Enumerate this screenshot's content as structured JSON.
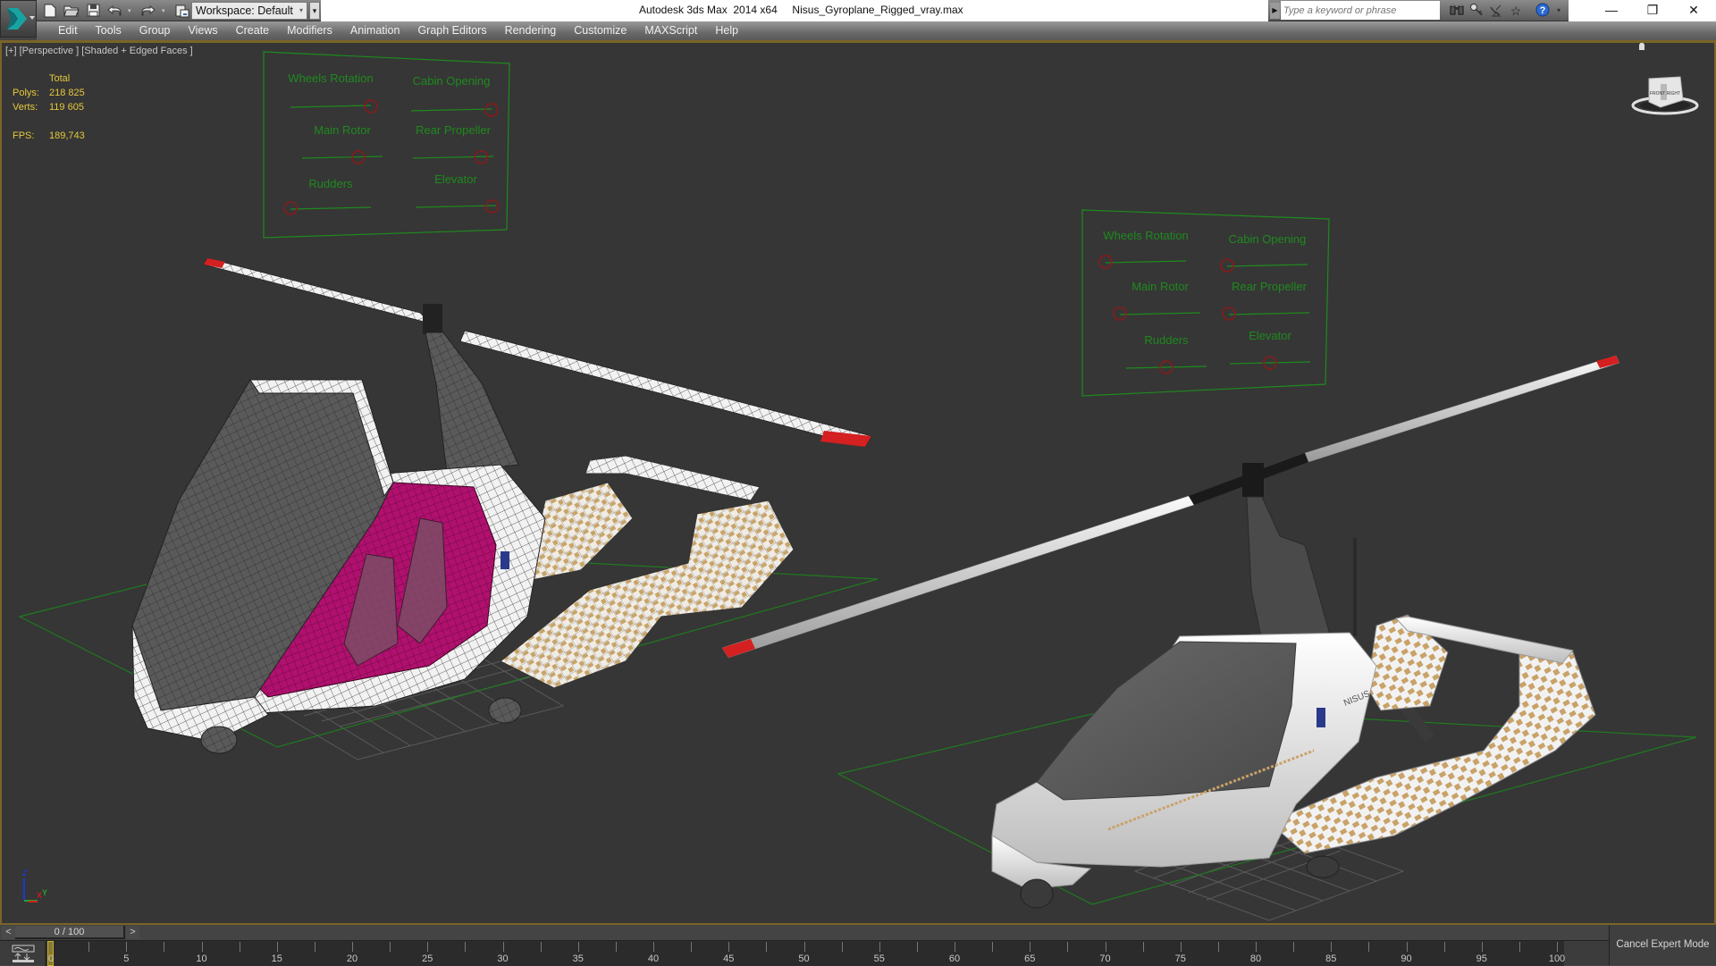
{
  "app": {
    "title": "Autodesk 3ds Max  2014 x64     Nisus_Gyroplane_Rigged_vray.max",
    "workspace": "Workspace: Default"
  },
  "quick_access": [
    {
      "name": "new-file-icon",
      "glyph": "🗋"
    },
    {
      "name": "open-file-icon",
      "glyph": "📂"
    },
    {
      "name": "save-icon",
      "glyph": "💾"
    },
    {
      "name": "undo-icon",
      "glyph": "↶"
    },
    {
      "name": "redo-icon",
      "glyph": "↷"
    },
    {
      "name": "project-folder-icon",
      "glyph": "🗂"
    }
  ],
  "search": {
    "placeholder": "Type a keyword or phrase"
  },
  "infocenter": [
    {
      "name": "binoculars-icon",
      "glyph": "⌕"
    },
    {
      "name": "key-icon",
      "glyph": "⚷"
    },
    {
      "name": "satellite-icon",
      "glyph": "📡"
    },
    {
      "name": "star-icon",
      "glyph": "☆"
    },
    {
      "name": "help-icon",
      "glyph": "?"
    }
  ],
  "window_controls": {
    "minimize": "—",
    "restore": "❐",
    "close": "✕"
  },
  "menu": [
    "Edit",
    "Tools",
    "Group",
    "Views",
    "Create",
    "Modifiers",
    "Animation",
    "Graph Editors",
    "Rendering",
    "Customize",
    "MAXScript",
    "Help"
  ],
  "viewport": {
    "label": "[+] [Perspective ] [Shaded + Edged Faces ]",
    "stats": {
      "header": "Total",
      "polys_label": "Polys:",
      "polys": "218 825",
      "verts_label": "Verts:",
      "verts": "119 605",
      "fps_label": "FPS:",
      "fps": "189,743"
    },
    "axis": {
      "z": "Z",
      "x": "X",
      "y": "Y"
    }
  },
  "rig_panels": [
    {
      "name": "rig-panel-left",
      "controls": [
        {
          "label": "Wheels Rotation",
          "value": 1.0
        },
        {
          "label": "Cabin Opening",
          "value": 1.0
        },
        {
          "label": "Main Rotor",
          "value": 0.7
        },
        {
          "label": "Rear Propeller",
          "value": 0.85
        },
        {
          "label": "Rudders",
          "value": 0.0
        },
        {
          "label": "Elevator",
          "value": 0.95
        }
      ]
    },
    {
      "name": "rig-panel-right",
      "controls": [
        {
          "label": "Wheels Rotation",
          "value": 0.0
        },
        {
          "label": "Cabin Opening",
          "value": 0.0
        },
        {
          "label": "Main Rotor",
          "value": 0.0
        },
        {
          "label": "Rear Propeller",
          "value": 0.0
        },
        {
          "label": "Rudders",
          "value": 0.5
        },
        {
          "label": "Elevator",
          "value": 0.5
        }
      ]
    }
  ],
  "colors": {
    "frame_accent": "#7a6428",
    "stats_text": "#e5c83a",
    "rig_green": "#1e8a1e",
    "rig_knob": "#8a1a1a",
    "cabin_magenta": "#b0106e"
  },
  "timeslider": {
    "prev": "<",
    "position": "0 / 100",
    "next": ">",
    "current": 0,
    "total": 100
  },
  "trackbar": {
    "ticks_major": [
      0,
      5,
      10,
      15,
      20,
      25,
      30,
      35,
      40,
      45,
      50,
      55,
      60,
      65,
      70,
      75,
      80,
      85,
      90,
      95,
      100
    ]
  },
  "status": {
    "expert_mode_button": "Cancel Expert Mode"
  }
}
